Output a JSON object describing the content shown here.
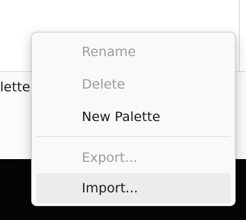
{
  "background": {
    "panel_text": "lette"
  },
  "context_menu": {
    "items": [
      {
        "label": "Rename",
        "enabled": false
      },
      {
        "label": "Delete",
        "enabled": false
      },
      {
        "label": "New Palette",
        "enabled": true
      },
      {
        "label": "Export...",
        "enabled": false
      },
      {
        "label": "Import...",
        "enabled": true,
        "hovered": true
      }
    ]
  },
  "colors": {
    "enabled_text": "#1b1b1b",
    "disabled_text": "#9b9b9b",
    "hover_background": "#ececec",
    "menu_background": "#f9f9f9",
    "bottom_background": "#050505"
  }
}
